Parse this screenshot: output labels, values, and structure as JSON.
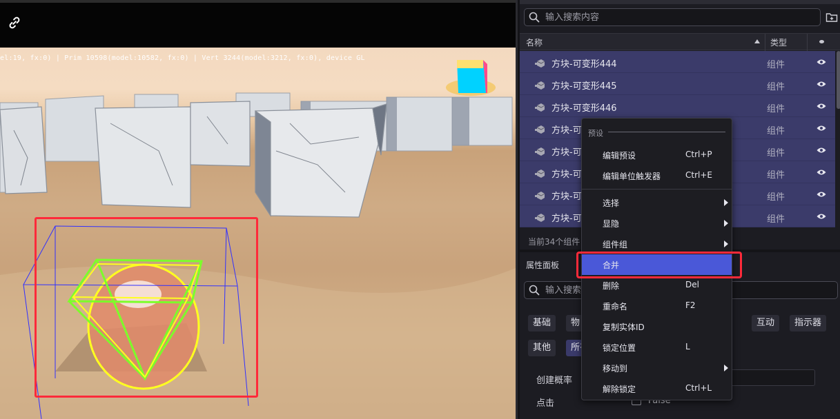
{
  "viewport": {
    "stats_text": "el:19, fx:0) | Prim 10598(model:10582, fx:0) | Vert 3244(model:3212, fx:0), device GL",
    "icons": {
      "link": "link-icon"
    }
  },
  "outliner": {
    "search_placeholder": "输入搜索内容",
    "columns": {
      "name": "名称",
      "type": "类型"
    },
    "rows": [
      {
        "name": "方块-可变形444",
        "type": "组件"
      },
      {
        "name": "方块-可变形445",
        "type": "组件"
      },
      {
        "name": "方块-可变形446",
        "type": "组件"
      },
      {
        "name": "方块-可",
        "type": "组件"
      },
      {
        "name": "方块-可",
        "type": "组件"
      },
      {
        "name": "方块-可",
        "type": "组件"
      },
      {
        "name": "方块-可",
        "type": "组件"
      },
      {
        "name": "方块-可",
        "type": "组件"
      }
    ],
    "count_text": "当前34个组件"
  },
  "properties": {
    "title": "属性面板",
    "search_placeholder": "输入搜索",
    "categories_row1": [
      "基础",
      "物",
      "互动",
      "指示器"
    ],
    "categories_row2": [
      "其他",
      "所有"
    ],
    "labels": {
      "create_prob": "创建概率",
      "click": "点击"
    },
    "checkbox_text": "False"
  },
  "context_menu": {
    "section_title": "预设",
    "group1": [
      {
        "label": "编辑预设",
        "shortcut": "Ctrl+P"
      },
      {
        "label": "编辑单位触发器",
        "shortcut": "Ctrl+E"
      }
    ],
    "group2": [
      {
        "label": "选择",
        "shortcut": ""
      },
      {
        "label": "显隐",
        "shortcut": ""
      },
      {
        "label": "组件组",
        "shortcut": ""
      },
      {
        "label": "合并",
        "shortcut": ""
      },
      {
        "label": "删除",
        "shortcut": "Del"
      },
      {
        "label": "重命名",
        "shortcut": "F2"
      },
      {
        "label": "复制实体ID",
        "shortcut": ""
      },
      {
        "label": "锁定位置",
        "shortcut": "L"
      },
      {
        "label": "移动到",
        "shortcut": ""
      },
      {
        "label": "解除锁定",
        "shortcut": "Ctrl+L"
      }
    ]
  },
  "colors": {
    "accent": "#4a58d8",
    "highlight_box": "#ff2a3a",
    "selected_row": "#3b3b6a"
  }
}
